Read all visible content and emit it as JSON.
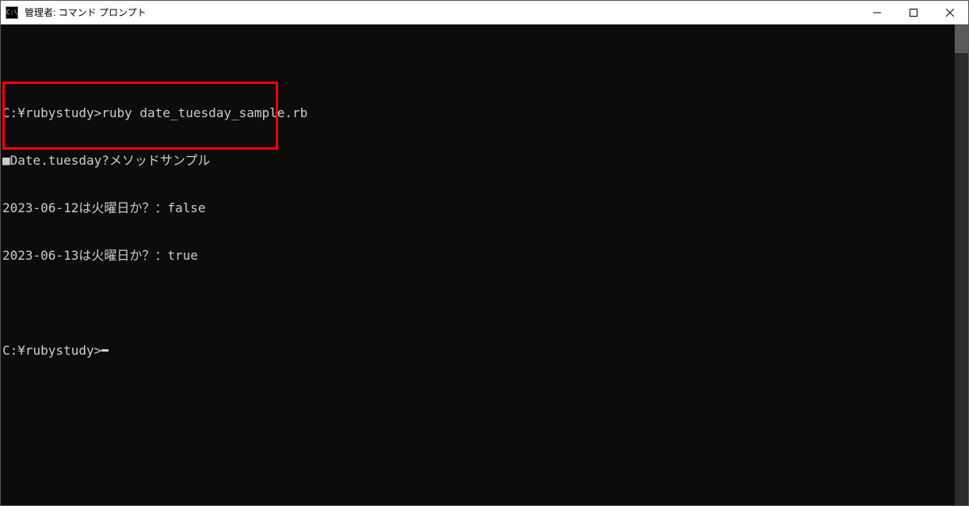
{
  "window": {
    "icon_text": "C:\\",
    "title": "管理者: コマンド プロンプト"
  },
  "terminal": {
    "lines": [
      "",
      "C:¥rubystudy>ruby date_tuesday_sample.rb",
      "■Date.tuesday?メソッドサンプル",
      "2023-06-12は火曜日か？：false",
      "2023-06-13は火曜日か？：true",
      "",
      "C:¥rubystudy>"
    ],
    "prompt_cursor": true
  }
}
